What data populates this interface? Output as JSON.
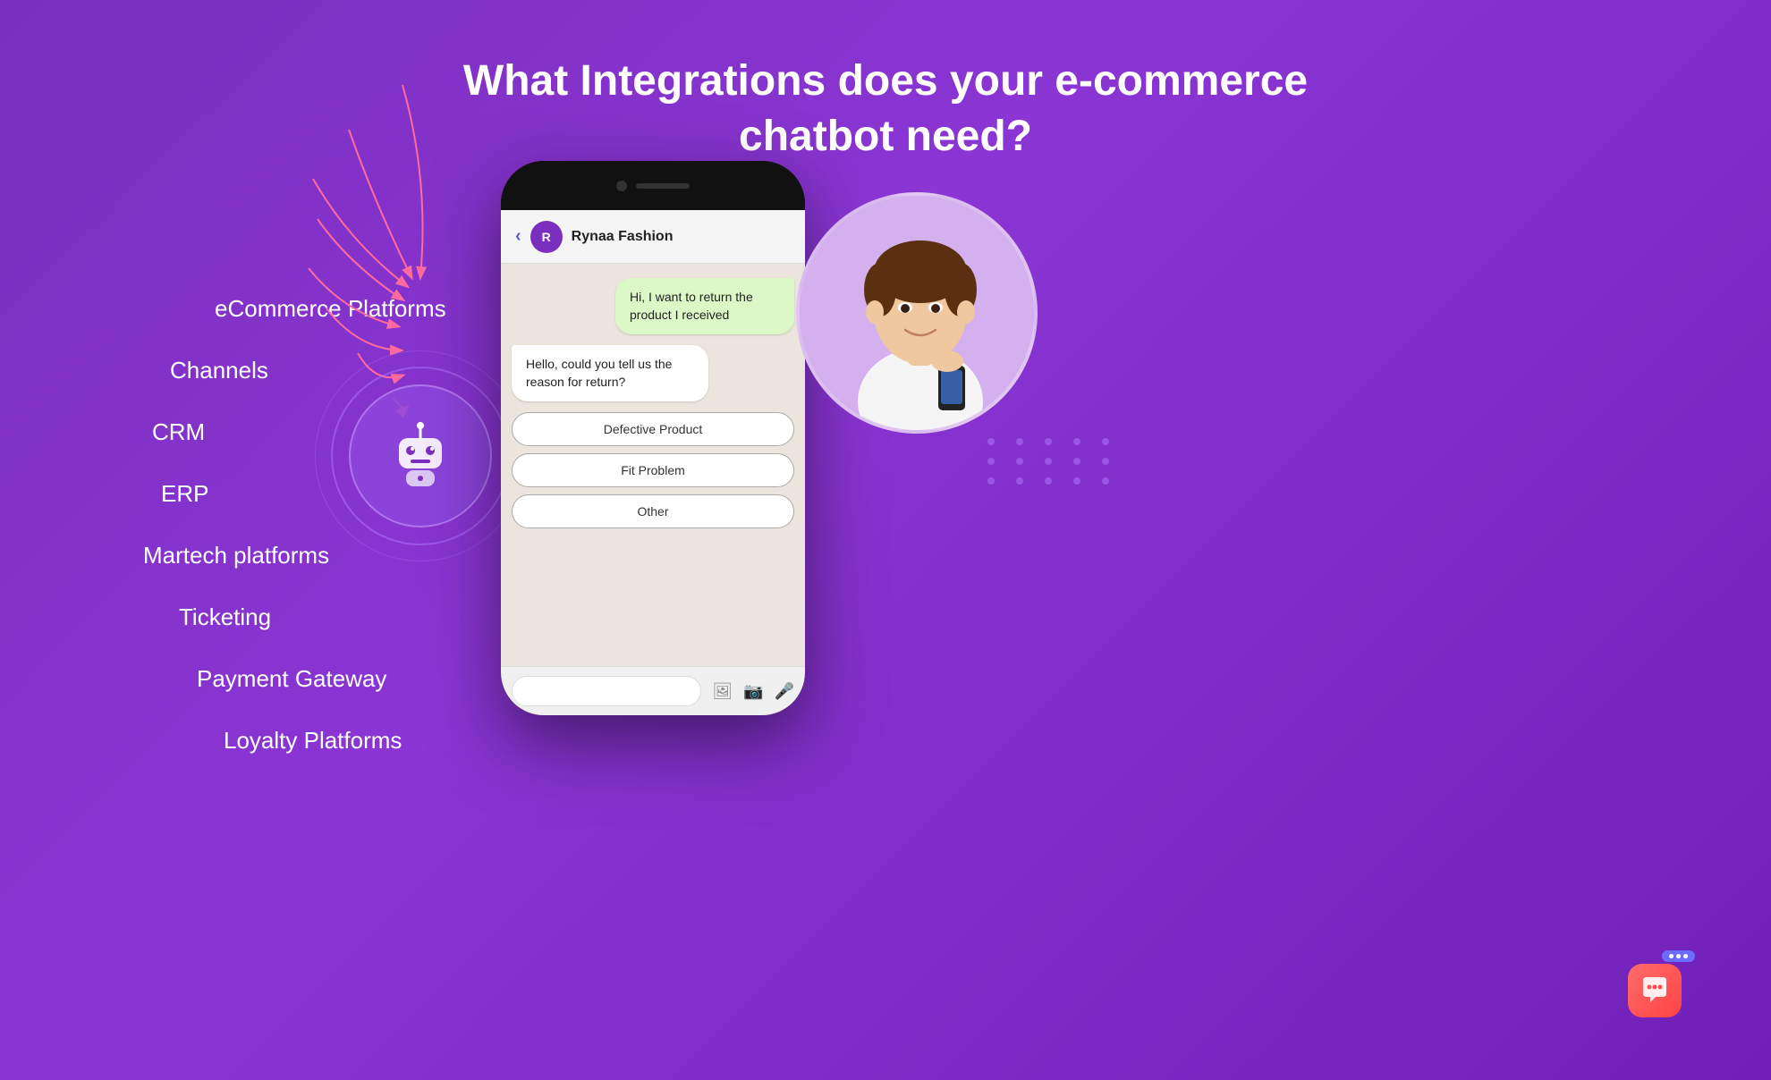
{
  "title": {
    "line1": "What Integrations does your e-commerce",
    "line2": "chatbot need?"
  },
  "labels": [
    {
      "id": "ecommerce-platforms",
      "text": "eCommerce Platforms"
    },
    {
      "id": "channels",
      "text": "Channels"
    },
    {
      "id": "crm",
      "text": "CRM"
    },
    {
      "id": "erp",
      "text": "ERP"
    },
    {
      "id": "martech-platforms",
      "text": "Martech platforms"
    },
    {
      "id": "ticketing",
      "text": "Ticketing"
    },
    {
      "id": "payment-gateway",
      "text": "Payment Gateway"
    },
    {
      "id": "loyalty-platforms",
      "text": "Loyalty Platforms"
    }
  ],
  "chat": {
    "header": {
      "back": "‹",
      "brand_initial": "R",
      "brand_name": "Rynaa Fashion"
    },
    "messages": [
      {
        "type": "user",
        "text": "Hi, I want to return the product I received"
      },
      {
        "type": "bot",
        "text": "Hello, could you tell us the reason for return?"
      }
    ],
    "options": [
      {
        "id": "defective-product",
        "label": "Defective Product"
      },
      {
        "id": "fit-problem",
        "label": "Fit Problem"
      },
      {
        "id": "other",
        "label": "Other"
      }
    ],
    "input_placeholder": ""
  },
  "dots": {
    "rows": 3,
    "cols": 5
  },
  "colors": {
    "bg": "#7B2FBE",
    "robot_bg": "#8A40CC",
    "option_border": "#aaa",
    "widget_red": "#FF5050",
    "widget_blue": "#6B6BFF"
  }
}
